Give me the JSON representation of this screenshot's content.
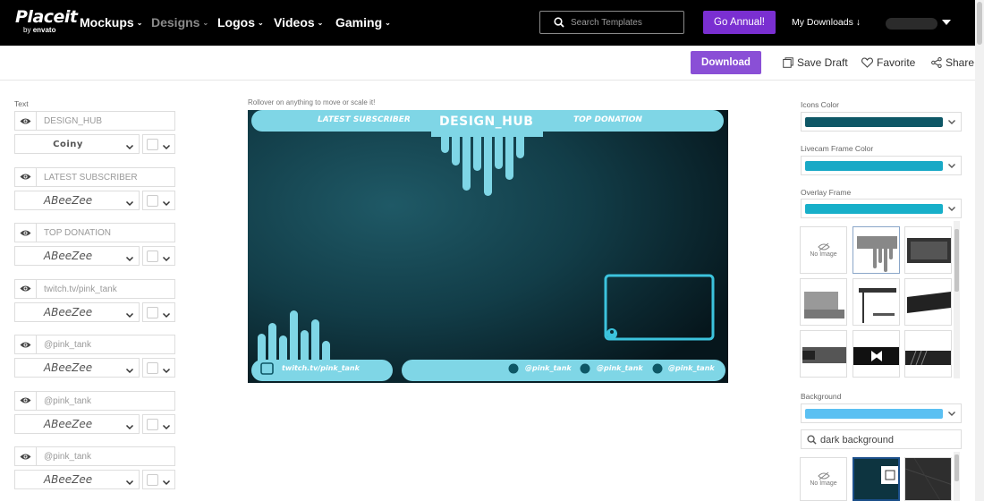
{
  "header": {
    "logo": {
      "main": "Placeit",
      "sub_by": "by",
      "sub_brand": "envato"
    },
    "nav": [
      {
        "label": "Mockups",
        "dim": false
      },
      {
        "label": "Designs",
        "dim": true
      },
      {
        "label": "Logos",
        "dim": false
      },
      {
        "label": "Videos",
        "dim": false
      },
      {
        "label": "Gaming",
        "dim": false
      }
    ],
    "search_placeholder": "Search Templates",
    "go_annual": "Go Annual!",
    "my_downloads": "My Downloads ↓"
  },
  "actions": {
    "download": "Download",
    "save_draft": "Save Draft",
    "favorite": "Favorite",
    "share": "Share"
  },
  "left_panel": {
    "section_label": "Text",
    "rows": [
      {
        "text": "DESIGN_HUB",
        "font": "Coiny"
      },
      {
        "text": "LATEST SUBSCRIBER",
        "font": "ABeeZee"
      },
      {
        "text": "TOP DONATION",
        "font": "ABeeZee"
      },
      {
        "text": "twitch.tv/pink_tank",
        "font": "ABeeZee"
      },
      {
        "text": "@pink_tank",
        "font": "ABeeZee"
      },
      {
        "text": "@pink_tank",
        "font": "ABeeZee"
      },
      {
        "text": "@pink_tank",
        "font": "ABeeZee"
      }
    ]
  },
  "canvas": {
    "hint": "Rollover on anything to move or scale it!",
    "latest_subscriber": "LATEST SUBSCRIBER",
    "design_hub": "DESIGN_HUB",
    "top_donation": "TOP DONATION",
    "twitch": "twitch.tv/pink_tank",
    "social_1": "@pink_tank",
    "social_2": "@pink_tank",
    "social_3": "@pink_tank"
  },
  "right_panel": {
    "icons_color_label": "Icons Color",
    "icons_color": "#0e5766",
    "livecam_label": "Livecam Frame Color",
    "livecam_color": "#19a9c6",
    "overlay_label": "Overlay Frame",
    "overlay_color": "#17afc9",
    "no_image": "No Image",
    "background_label": "Background",
    "background_color": "#5bc0f2",
    "bg_search_value": "dark background"
  },
  "colors": {
    "accent_purple": "#7a2fd1",
    "download_purple": "#8a4fd6",
    "canvas_teal": "#7fd6e6"
  }
}
